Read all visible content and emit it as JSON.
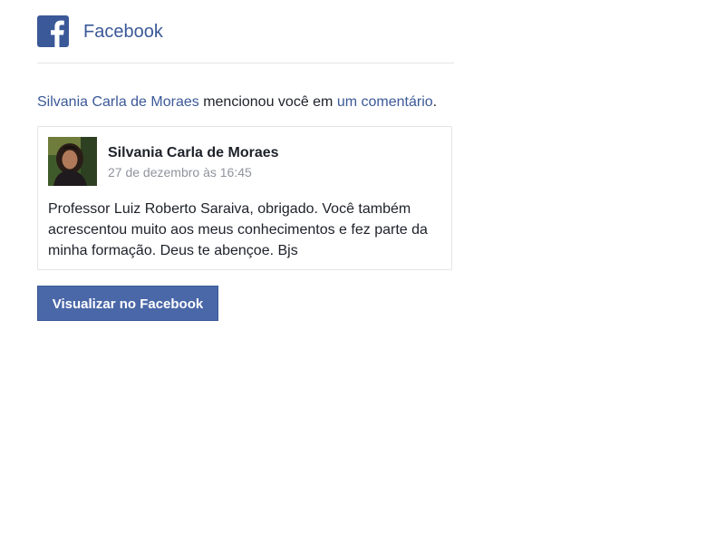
{
  "header": {
    "brand": "Facebook",
    "logo_icon": "facebook-f-icon",
    "brand_color": "#3b5998"
  },
  "notification": {
    "actor": "Silvania Carla de Moraes",
    "action_text": " mencionou você em ",
    "target_link": "um comentário",
    "end_punctuation": "."
  },
  "comment": {
    "author": "Silvania Carla de Moraes",
    "timestamp": "27 de dezembro às 16:45",
    "body": "Professor Luiz Roberto Saraiva, obrigado. Você também acrescentou muito aos meus conhecimentos e fez parte da minha formação. Deus te abençoe. Bjs",
    "avatar_icon": "profile-photo"
  },
  "actions": {
    "view_button": "Visualizar no Facebook",
    "button_color": "#4a67a8"
  }
}
